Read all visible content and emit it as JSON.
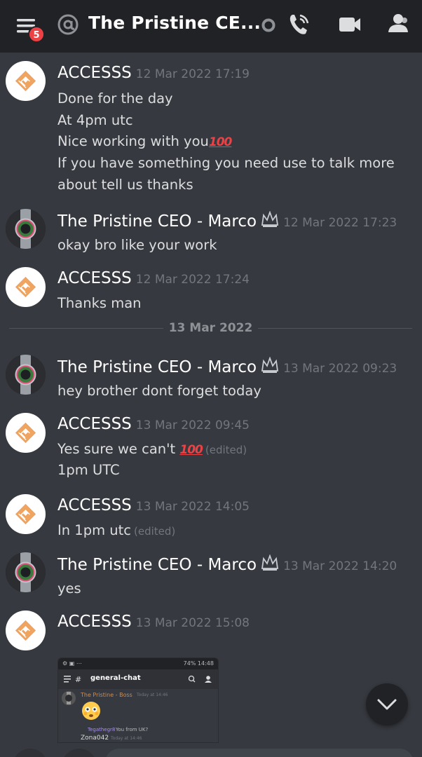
{
  "header": {
    "badge_count": "5",
    "title": "The Pristine CE..."
  },
  "divider_date": "13 Mar 2022",
  "messages": [
    {
      "author": "ACCESSS",
      "timestamp": "12 Mar 2022 17:19",
      "lines": [
        "Done for the day",
        "At 4pm utc",
        "Nice working with you",
        "If you have something you need use to talk more",
        "about tell us thanks"
      ]
    },
    {
      "author": "The Pristine CEO - Marco",
      "timestamp": "12 Mar 2022 17:23",
      "lines": [
        "okay bro like your work"
      ]
    },
    {
      "author": "ACCESSS",
      "timestamp": "12 Mar 2022 17:24",
      "lines": [
        "Thanks man"
      ]
    },
    {
      "author": "The Pristine CEO - Marco",
      "timestamp": "13 Mar 2022 09:23",
      "lines": [
        "hey brother dont forget today"
      ]
    },
    {
      "author": "ACCESSS",
      "timestamp": "13 Mar 2022 09:45",
      "lines": [
        "Yes sure we can't ",
        "1pm UTC"
      ],
      "edited": "(edited)"
    },
    {
      "author": "ACCESSS",
      "timestamp": "13 Mar 2022 14:05",
      "lines": [
        "In 1pm utc"
      ],
      "edited": "(edited)"
    },
    {
      "author": "The Pristine CEO - Marco",
      "timestamp": "13 Mar 2022 14:20",
      "lines": [
        "yes"
      ]
    },
    {
      "author": "ACCESSS",
      "timestamp": "13 Mar 2022 15:08",
      "lines": []
    }
  ],
  "emoji_100": "100",
  "attachment": {
    "status_right": "74% 14:48",
    "channel": "general-chat",
    "author": "The Pristine - Boss",
    "time": "Today at 14:46",
    "reply_author": "Tegathegr8",
    "reply_text": "You from UK?",
    "next_author": "Zona042",
    "next_time": "Today at 14:46"
  },
  "colors": {
    "background": "#36393f",
    "header": "#202225",
    "badge": "#ed4245",
    "access_logo": "#f0a35e"
  }
}
